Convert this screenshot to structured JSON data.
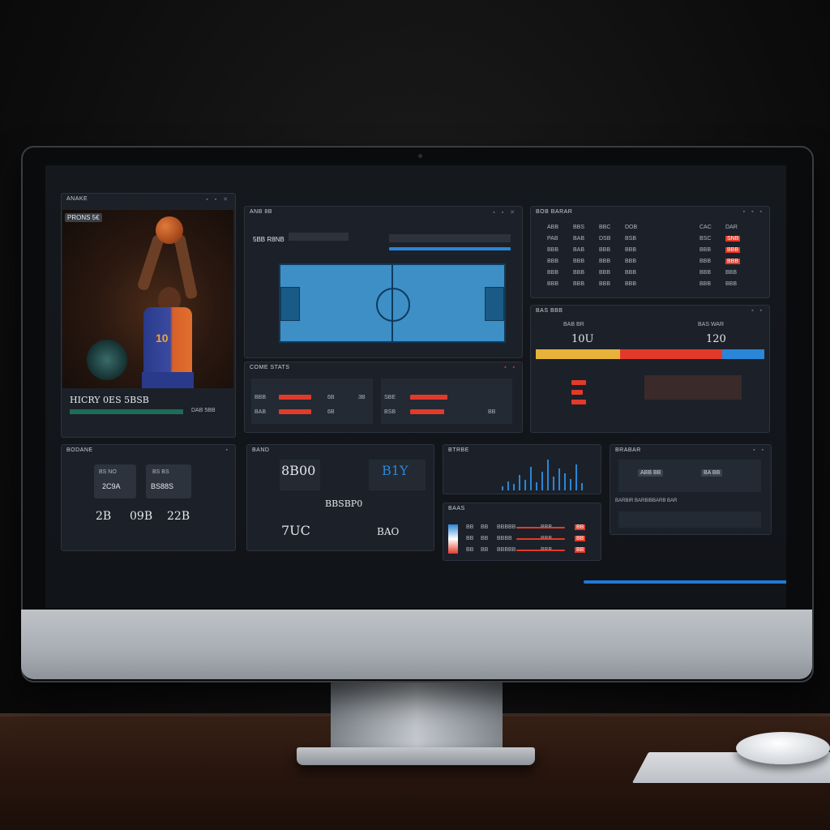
{
  "player": {
    "header": "ANAKE",
    "badge": "PRONS 5€",
    "name": "HICRY 0ES 5BSB",
    "stat_tag": "DAB 5BB"
  },
  "court_panel": {
    "title": "ANB 8B",
    "subtitle": "5BB R8NB"
  },
  "game_stats": {
    "title": "COME STATS",
    "rows": [
      {
        "a": "BBB",
        "b": "SBE",
        "c": "6B",
        "d": "3B"
      },
      {
        "a": "BAB",
        "b": "BSB",
        "c": "6B",
        "d": "BB"
      }
    ]
  },
  "team_table": {
    "title": "BOB BARAR",
    "headers": [
      "ABB",
      "BBS",
      "BBC",
      "DOB",
      "CAC",
      "DAR"
    ],
    "rows": [
      [
        "PAB",
        "BAB",
        "DSB",
        "BSB",
        "BSC",
        "SNB"
      ],
      [
        "BBB",
        "BAB",
        "BBB",
        "BBB",
        "BBB",
        "BBB"
      ],
      [
        "BBB",
        "BBB",
        "BBB",
        "BBB",
        "BBB",
        "BBB"
      ],
      [
        "BBB",
        "BBB",
        "BBB",
        "BBB",
        "BBB",
        "BBB"
      ],
      [
        "BBB",
        "BBB",
        "BBB",
        "BBB",
        "BBB",
        "BBB"
      ]
    ]
  },
  "score_compare": {
    "title": "BAS BBB",
    "left_score": "10U",
    "right_score": "120",
    "left_label": "BAB BR",
    "right_label": "BAS WAR",
    "colors": {
      "a": "#e8b23a",
      "b": "#e23a2a",
      "c": "#2a86d8"
    }
  },
  "summary": {
    "title": "BODANE",
    "tiles": [
      {
        "top": "BS NO",
        "bottom": "2C9A"
      },
      {
        "top": "BS BS",
        "bottom": "BS88S"
      }
    ],
    "values": [
      "2B",
      "09B",
      "22B"
    ]
  },
  "score_board": {
    "title": "BAND",
    "score1": "8B00",
    "score2": "B1Y",
    "mid": "BBSBP0",
    "score3": "7UC",
    "score4": "BAO"
  },
  "trend": {
    "title": "BTRBE",
    "values": [
      5,
      12,
      8,
      20,
      14,
      30,
      10,
      24,
      40,
      18,
      28,
      22,
      15,
      34,
      9
    ]
  },
  "roster": {
    "title": "BAAS",
    "rows": [
      [
        "BB",
        "BB",
        "BBBBB",
        "BBB",
        "BB"
      ],
      [
        "BB",
        "BB",
        "BBBB",
        "BBB",
        "BB"
      ],
      [
        "BB",
        "BB",
        "BBBBB",
        "BBB",
        "BB"
      ]
    ]
  },
  "controls": {
    "title": "BRABAR",
    "btn1": "ABB BB",
    "btn2": "BA BB",
    "caption": "BARBIR BARBIBBARB BAR"
  }
}
